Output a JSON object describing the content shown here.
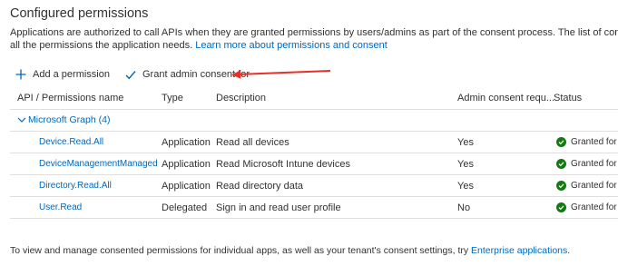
{
  "section": {
    "title": "Configured permissions",
    "intro_line1": "Applications are authorized to call APIs when they are granted permissions by users/admins as part of the consent process. The list of configured permissio",
    "intro_line2": "all the permissions the application needs.",
    "learn_more_link": "Learn more about permissions and consent"
  },
  "toolbar": {
    "add_label": "Add a permission",
    "grant_label": "Grant admin consent for"
  },
  "table": {
    "headers": {
      "name": "API / Permissions name",
      "type": "Type",
      "description": "Description",
      "admin_consent": "Admin consent requ...",
      "status": "Status"
    },
    "group": {
      "label": "Microsoft Graph (4)"
    },
    "rows": [
      {
        "name": "Device.Read.All",
        "type": "Application",
        "description": "Read all devices",
        "admin_consent": "Yes",
        "status": "Granted for M"
      },
      {
        "name": "DeviceManagementManagedDe",
        "type": "Application",
        "description": "Read Microsoft Intune devices",
        "admin_consent": "Yes",
        "status": "Granted for M"
      },
      {
        "name": "Directory.Read.All",
        "type": "Application",
        "description": "Read directory data",
        "admin_consent": "Yes",
        "status": "Granted for M"
      },
      {
        "name": "User.Read",
        "type": "Delegated",
        "description": "Sign in and read user profile",
        "admin_consent": "No",
        "status": "Granted for M"
      }
    ]
  },
  "footer": {
    "text": "To view and manage consented permissions for individual apps, as well as your tenant's consent settings, try ",
    "link": "Enterprise applications",
    "suffix": "."
  },
  "colors": {
    "link": "#0067b8",
    "success": "#107c10",
    "annotation_arrow": "#e8302a"
  },
  "icons": {
    "add": "plus-icon",
    "grant": "checkmark-icon",
    "group_toggle": "chevron-down-icon",
    "status": "success-check-circle-icon"
  }
}
